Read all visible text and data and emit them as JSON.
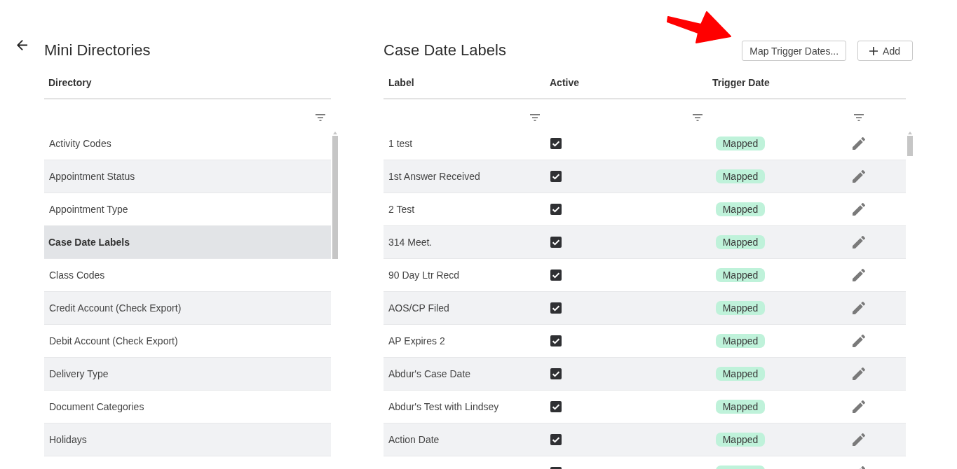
{
  "directories": {
    "title": "Mini Directories",
    "columns": [
      "Directory"
    ],
    "items": [
      {
        "label": "Activity Codes",
        "selected": false
      },
      {
        "label": "Appointment Status",
        "selected": false
      },
      {
        "label": "Appointment Type",
        "selected": false
      },
      {
        "label": "Case Date Labels",
        "selected": true
      },
      {
        "label": "Class Codes",
        "selected": false
      },
      {
        "label": "Credit Account (Check Export)",
        "selected": false
      },
      {
        "label": "Debit Account (Check Export)",
        "selected": false
      },
      {
        "label": "Delivery Type",
        "selected": false
      },
      {
        "label": "Document Categories",
        "selected": false
      },
      {
        "label": "Holidays",
        "selected": false
      }
    ]
  },
  "case_date_labels": {
    "title": "Case Date Labels",
    "buttons": [
      {
        "kind": "text",
        "label": "Map Trigger Dates..."
      },
      {
        "kind": "add",
        "label": "Add"
      }
    ],
    "columns": [
      "Label",
      "Active",
      "Trigger Date"
    ],
    "rows": [
      {
        "label": "1 test",
        "active": true,
        "mapped": true,
        "trigger": "Mapped"
      },
      {
        "label": "1st Answer Received",
        "active": true,
        "mapped": true,
        "trigger": "Mapped"
      },
      {
        "label": "2 Test",
        "active": true,
        "mapped": true,
        "trigger": "Mapped"
      },
      {
        "label": "314 Meet.",
        "active": true,
        "mapped": true,
        "trigger": "Mapped"
      },
      {
        "label": "90 Day Ltr Recd",
        "active": true,
        "mapped": true,
        "trigger": "Mapped"
      },
      {
        "label": "AOS/CP Filed",
        "active": true,
        "mapped": true,
        "trigger": "Mapped"
      },
      {
        "label": "AP Expires 2",
        "active": true,
        "mapped": true,
        "trigger": "Mapped"
      },
      {
        "label": "Abdur's Case Date",
        "active": true,
        "mapped": true,
        "trigger": "Mapped"
      },
      {
        "label": "Abdur's Test with Lindsey",
        "active": true,
        "mapped": true,
        "trigger": "Mapped"
      },
      {
        "label": "Action Date",
        "active": true,
        "mapped": true,
        "trigger": "Mapped"
      },
      {
        "active": true,
        "mapped": true
      }
    ]
  }
}
